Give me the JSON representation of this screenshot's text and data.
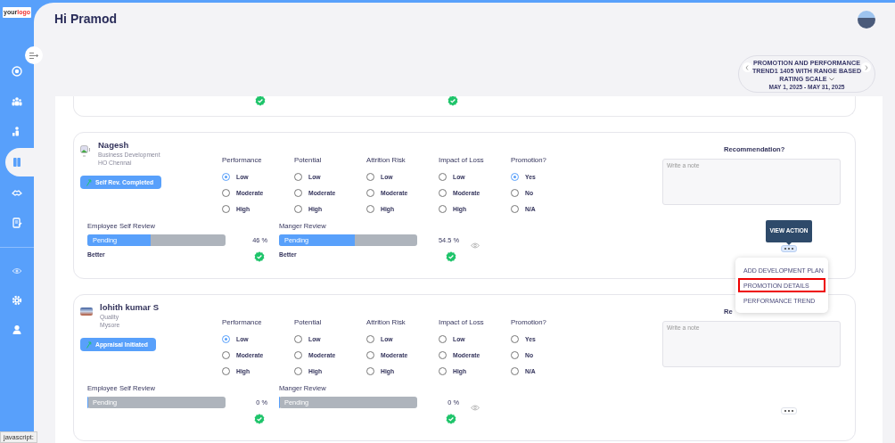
{
  "sidebar": {
    "logo_text": "your",
    "logo_accent": "logo",
    "items": [
      {
        "selected": false
      },
      {
        "selected": false
      },
      {
        "selected": false
      },
      {
        "selected": true
      },
      {
        "selected": false
      },
      {
        "selected": false
      }
    ],
    "bottom_items": [
      {
        "selected": false
      },
      {
        "selected": false
      },
      {
        "selected": false
      }
    ]
  },
  "header": {
    "greeting": "Hi Pramod"
  },
  "period": {
    "title": "PROMOTION AND PERFORMANCE TREND1 1405 WITH RANGE BASED RATING SCALE",
    "dates": "MAY 1, 2025 - MAY 31, 2025"
  },
  "cards": [
    {
      "name": "Nagesh",
      "department": "Business Development",
      "location": "HO Chennai",
      "avatar": {
        "kind": "broken-image"
      },
      "status": "Self Rev. Completed",
      "menu_open": true,
      "ratings": [
        {
          "heading": "Performance",
          "options": [
            {
              "label": "Low",
              "selected": true
            },
            {
              "label": "Moderate",
              "selected": false
            },
            {
              "label": "High",
              "selected": false
            }
          ]
        },
        {
          "heading": "Potential",
          "options": [
            {
              "label": "Low",
              "selected": false
            },
            {
              "label": "Moderate",
              "selected": false
            },
            {
              "label": "High",
              "selected": false
            }
          ]
        },
        {
          "heading": "Attrition Risk",
          "options": [
            {
              "label": "Low",
              "selected": false
            },
            {
              "label": "Moderate",
              "selected": false
            },
            {
              "label": "High",
              "selected": false
            }
          ]
        },
        {
          "heading": "Impact of Loss",
          "options": [
            {
              "label": "Low",
              "selected": false
            },
            {
              "label": "Moderate",
              "selected": false
            },
            {
              "label": "High",
              "selected": false
            }
          ]
        },
        {
          "heading": "Promotion?",
          "options": [
            {
              "label": "Yes",
              "selected": true
            },
            {
              "label": "No",
              "selected": false
            },
            {
              "label": "N/A",
              "selected": false
            }
          ]
        }
      ],
      "recommendation_label": "Recommendation?",
      "note_placeholder": "Write a note",
      "reviews": [
        {
          "title": "Employee Self Review",
          "status": "Pending",
          "level": 0.46,
          "percent": "46 %",
          "rating": "Better"
        },
        {
          "title": "Manger Review",
          "status": "Pending",
          "level": 0.55,
          "percent": "54.5 %",
          "rating": "Better"
        }
      ]
    },
    {
      "name": "lohith kumar S",
      "department": "Quality",
      "location": "Mysore",
      "avatar": {
        "kind": "photo"
      },
      "status": "Appraisal Initiated",
      "menu_open": false,
      "ratings": [
        {
          "heading": "Performance",
          "options": [
            {
              "label": "Low",
              "selected": true
            },
            {
              "label": "Moderate",
              "selected": false
            },
            {
              "label": "High",
              "selected": false
            }
          ]
        },
        {
          "heading": "Potential",
          "options": [
            {
              "label": "Low",
              "selected": false
            },
            {
              "label": "Moderate",
              "selected": false
            },
            {
              "label": "High",
              "selected": false
            }
          ]
        },
        {
          "heading": "Attrition Risk",
          "options": [
            {
              "label": "Low",
              "selected": false
            },
            {
              "label": "Moderate",
              "selected": false
            },
            {
              "label": "High",
              "selected": false
            }
          ]
        },
        {
          "heading": "Impact of Loss",
          "options": [
            {
              "label": "Low",
              "selected": false
            },
            {
              "label": "Moderate",
              "selected": false
            },
            {
              "label": "High",
              "selected": false
            }
          ]
        },
        {
          "heading": "Promotion?",
          "options": [
            {
              "label": "Yes",
              "selected": false
            },
            {
              "label": "No",
              "selected": false
            },
            {
              "label": "N/A",
              "selected": false
            }
          ]
        }
      ],
      "recommendation_label": "Re",
      "note_placeholder": "Write a note",
      "reviews": [
        {
          "title": "Employee Self Review",
          "status": "Pending",
          "level": 0,
          "percent": "0 %"
        },
        {
          "title": "Manger Review",
          "status": "Pending",
          "level": 0,
          "percent": "0 %"
        }
      ]
    }
  ],
  "action_menu": {
    "tooltip": "VIEW ACTION",
    "items": [
      {
        "label": "ADD DEVELOPMENT PLAN",
        "highlighted": false
      },
      {
        "label": "PROMOTION DETAILS",
        "highlighted": true
      },
      {
        "label": "PERFORMANCE TREND",
        "highlighted": false
      }
    ]
  },
  "status_bar": {
    "text": "javascript:"
  }
}
